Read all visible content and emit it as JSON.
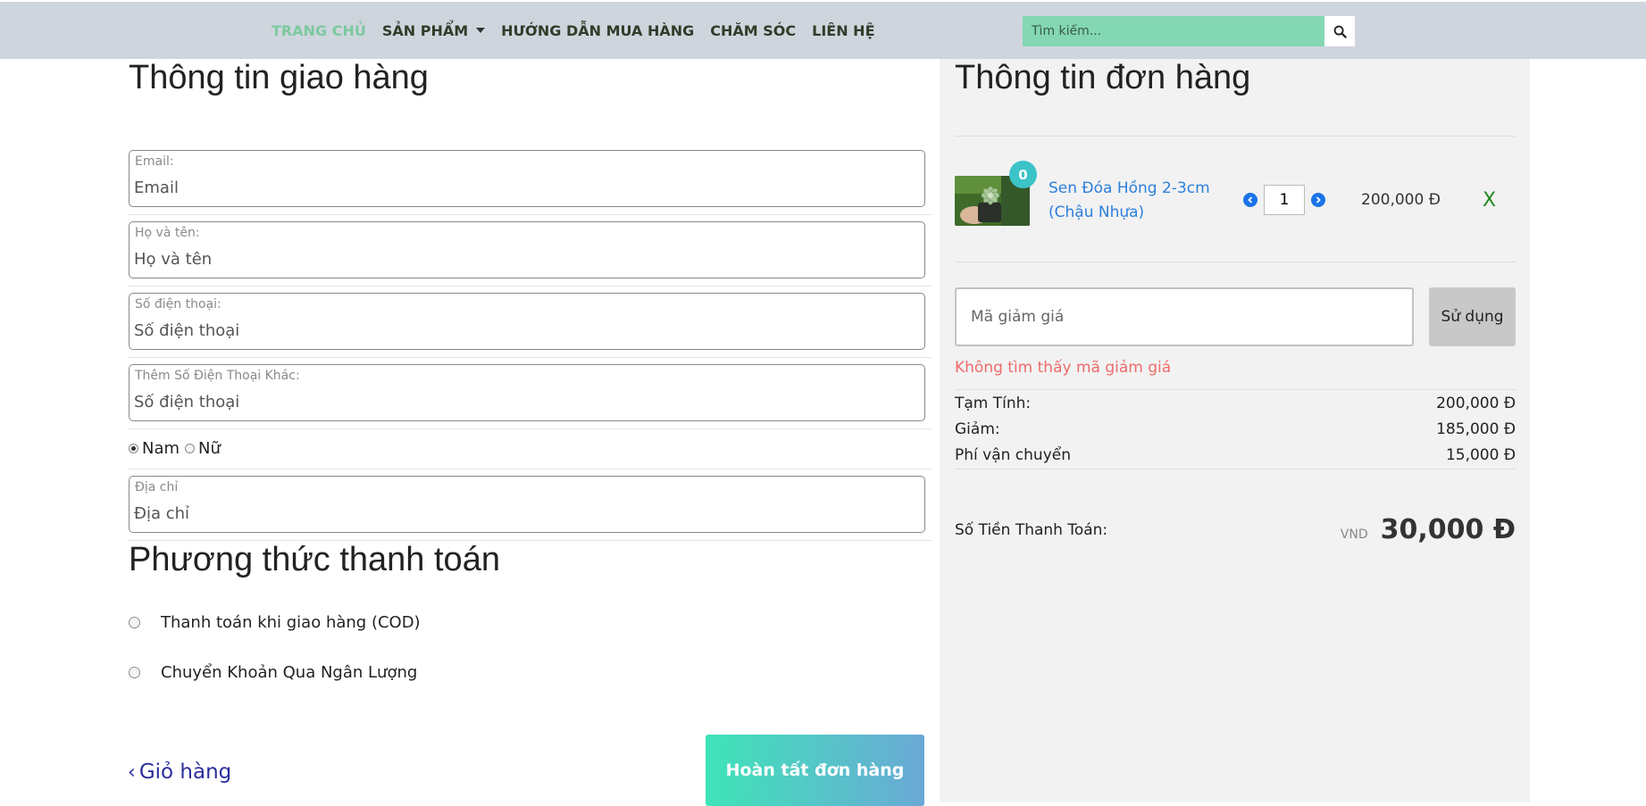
{
  "nav": {
    "items": [
      {
        "label": "TRANG CHỦ",
        "active": true
      },
      {
        "label": "SẢN PHẨM",
        "dropdown": true
      },
      {
        "label": "HƯỚNG DẪN MUA HÀNG"
      },
      {
        "label": "CHĂM SÓC"
      },
      {
        "label": "LIÊN HỆ"
      }
    ],
    "search_placeholder": "Tìm kiếm..."
  },
  "shipping": {
    "title": "Thông tin giao hàng",
    "fields": [
      {
        "label": "Email:",
        "placeholder": "Email"
      },
      {
        "label": "Họ và tên:",
        "placeholder": "Họ và tên"
      },
      {
        "label": "Số điện thoại:",
        "placeholder": "Số điện thoại"
      },
      {
        "label": "Thêm Số Điện Thoại Khác:",
        "placeholder": "Số điện thoại"
      }
    ],
    "gender": {
      "male": "Nam",
      "female": "Nữ",
      "selected": "Nam"
    },
    "address": {
      "label": "Địa chỉ",
      "placeholder": "Địa chỉ"
    }
  },
  "payment": {
    "title": "Phương thức thanh toán",
    "options": [
      "Thanh toán khi giao hàng (COD)",
      "Chuyển Khoản Qua Ngân Lượng"
    ]
  },
  "actions": {
    "back": "Giỏ hàng",
    "finish": "Hoàn tất đơn hàng"
  },
  "order": {
    "title": "Thông tin đơn hàng",
    "item": {
      "badge": "0",
      "name": "Sen Đóa Hồng 2-3cm (Chậu Nhựa)",
      "quantity": "1",
      "price": "200,000 Đ",
      "remove": "X"
    },
    "coupon_placeholder": "Mã giảm giá",
    "coupon_button": "Sử dụng",
    "coupon_error": "Không tìm thấy mã giảm giá",
    "summary": [
      {
        "label": "Tạm Tính:",
        "value": "200,000 Đ"
      },
      {
        "label": "Giảm:",
        "value": "185,000 Đ"
      },
      {
        "label": "Phí vận chuyển",
        "value": "15,000 Đ"
      }
    ],
    "total_label": "Số Tiền Thanh Toán:",
    "total_currency": "VND",
    "total_value": "30,000 Đ"
  },
  "colors": {
    "nav_bg": "#cfd5dd",
    "search_bg": "#83d7b3",
    "badge": "#3cc3c8",
    "link": "#2c7fdc",
    "error": "#ef6a6a",
    "finish_gradient_start": "#3fe4b8",
    "finish_gradient_end": "#6aa9d6"
  }
}
